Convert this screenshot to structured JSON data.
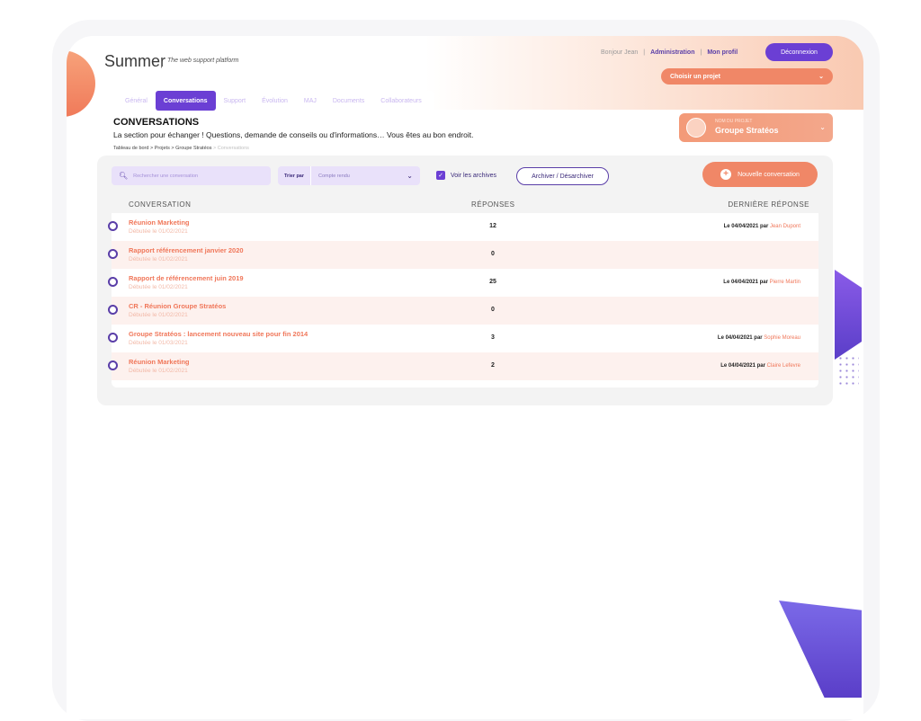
{
  "app": {
    "brand": "Summer",
    "separator": "|",
    "tagline": "The web support platform"
  },
  "topnav": {
    "greeting": "Bonjour Jean",
    "admin": "Administration",
    "profile": "Mon profil",
    "logout": "Déconnexion",
    "project_select": "Choisir un projet"
  },
  "tabs": [
    {
      "label": "Général"
    },
    {
      "label": "Conversations",
      "active": true
    },
    {
      "label": "Support"
    },
    {
      "label": "Évolution"
    },
    {
      "label": "MAJ"
    },
    {
      "label": "Documents"
    },
    {
      "label": "Collaborateurs"
    }
  ],
  "section": {
    "title": "CONVERSATIONS",
    "description": "La section pour échanger ! Questions, demande de conseils ou d'informations… Vous êtes au bon endroit.",
    "breadcrumb": "Tableau de bord > Projets > Groupe Stratéos",
    "breadcrumb_current": " > Conversations"
  },
  "project_card": {
    "label": "NOM DU PROJET",
    "name": "Groupe Stratéos"
  },
  "toolbar": {
    "search_placeholder": "Rechercher une conversation",
    "sort_label": "Trier par",
    "sort_value": "Compte rendu",
    "archives_label": "Voir les archives",
    "archive_button": "Archiver / Désarchiver",
    "new_conversation": "Nouvelle conversation"
  },
  "table": {
    "headers": [
      "CONVERSATION",
      "RÉPONSES",
      "DERNIÈRE RÉPONSE"
    ],
    "rows": [
      {
        "title": "Réunion Marketing",
        "started": "Débutée le 01/02/2021",
        "responses": "12",
        "last": "Le 04/04/2021 par",
        "author": "Jean Dupont"
      },
      {
        "title": "Rapport référencement janvier 2020",
        "started": "Débutée le 01/02/2021",
        "responses": "0",
        "last": "",
        "author": ""
      },
      {
        "title": "Rapport de référencement juin 2019",
        "started": "Débutée le 01/02/2021",
        "responses": "25",
        "last": "Le 04/04/2021 par",
        "author": "Pierre Martin"
      },
      {
        "title": "CR - Réunion Groupe Stratéos",
        "started": "Débutée le 01/02/2021",
        "responses": "0",
        "last": "",
        "author": ""
      },
      {
        "title": "Groupe Stratéos : lancement nouveau site pour fin 2014",
        "started": "Débutée le 01/03/2021",
        "responses": "3",
        "last": "Le 04/04/2021 par",
        "author": "Sophie Moreau"
      },
      {
        "title": "Réunion Marketing",
        "started": "Débutée le 01/02/2021",
        "responses": "2",
        "last": "Le 04/04/2021 par",
        "author": "Claire Lefevre"
      }
    ]
  },
  "colors": {
    "accent": "#6b3fd4",
    "brand_orange": "#f08767",
    "row_alt": "#fdf1ee"
  },
  "icons": {
    "search": "search-icon",
    "chevron": "chevron-down-icon",
    "check": "check-icon",
    "plus": "plus-icon",
    "radio": "radio-icon"
  }
}
